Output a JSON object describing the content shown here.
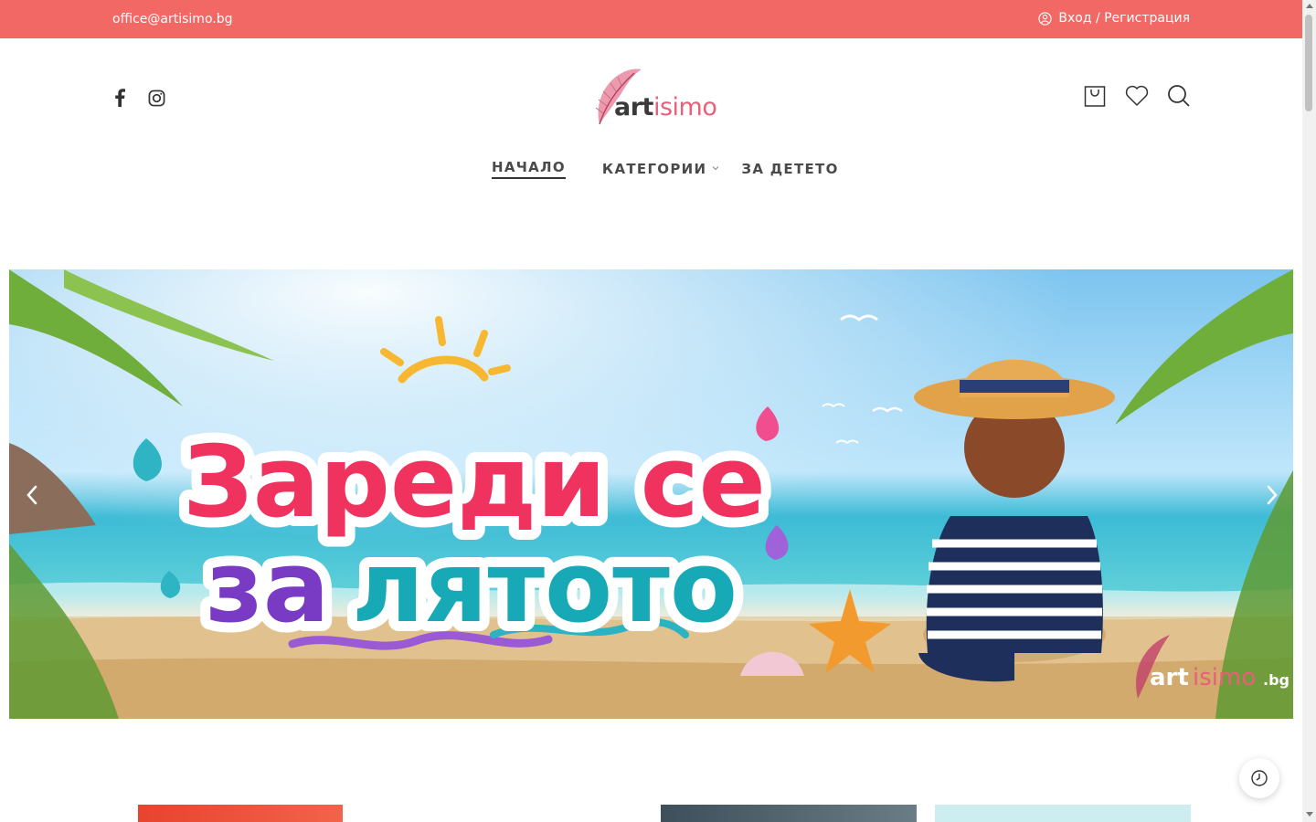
{
  "topbar": {
    "email": "office@artisimo.bg",
    "login_label": "Вход / Регистрация",
    "background_color": "#f26864"
  },
  "header": {
    "social_icons": [
      "facebook-icon",
      "instagram-icon"
    ],
    "logo": {
      "art": "art",
      "isimo": "isimo",
      "icon": "feather-logo-icon"
    },
    "action_icons": [
      "cart-icon",
      "heart-icon",
      "search-icon"
    ]
  },
  "nav": {
    "items": [
      {
        "label": "НАЧАЛО",
        "active": true
      },
      {
        "label": "КАТЕГОРИИ",
        "has_dropdown": true
      },
      {
        "label": "ЗА ДЕТЕТО"
      }
    ]
  },
  "hero": {
    "line1": "Зареди се",
    "line2_part1": "за",
    "line2_part2": "лятото",
    "watermark_art": "art",
    "watermark_isimo": "isimo",
    "watermark_tld": ".bg",
    "prev_icon": "chevron-left-icon",
    "next_icon": "chevron-right-icon",
    "colors": {
      "pink": "#f0325f",
      "purple": "#7a3bc4",
      "teal": "#17a9b5"
    }
  },
  "floating": {
    "history_icon": "clock-icon"
  }
}
